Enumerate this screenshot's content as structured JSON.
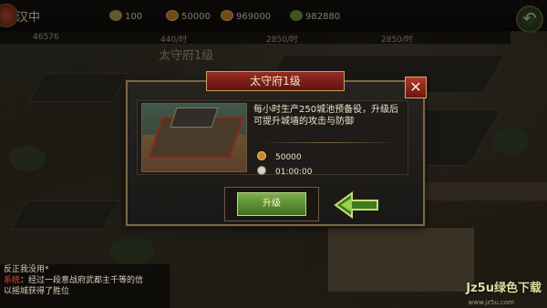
{
  "hud": {
    "location": "汉中",
    "resources": [
      {
        "icon": "food-icon",
        "value": "100"
      },
      {
        "icon": "coin-icon",
        "value": "50000"
      },
      {
        "icon": "grain-icon",
        "value": "969000"
      },
      {
        "icon": "gem-icon",
        "value": "982880"
      }
    ],
    "stats": [
      "46576",
      "440/时",
      "2850/时",
      "2850/时"
    ],
    "back_label": "↶"
  },
  "building_name": "太守府1级",
  "dialog": {
    "title": "太守府1级",
    "close_label": "✕",
    "description": "每小时生产250城池预备役，升级后可提升城墙的攻击与防御",
    "cost": {
      "coins": "50000",
      "time": "01:00:00"
    },
    "upgrade_label": "升级"
  },
  "chat": {
    "lines": [
      {
        "prefix": "",
        "text": "反正我没用*"
      },
      {
        "prefix": "系统",
        "text": "：经过一段意战府武都主千等的信"
      },
      {
        "prefix": "",
        "text": "以摇城获得了胜位"
      }
    ]
  },
  "watermark": {
    "main": "Jz5u绿色下载",
    "sub": "www.jz5u.com"
  },
  "colors": {
    "accent_red": "#9b2b22",
    "button_green": "#5e9034",
    "gold_border": "#7a6646"
  }
}
